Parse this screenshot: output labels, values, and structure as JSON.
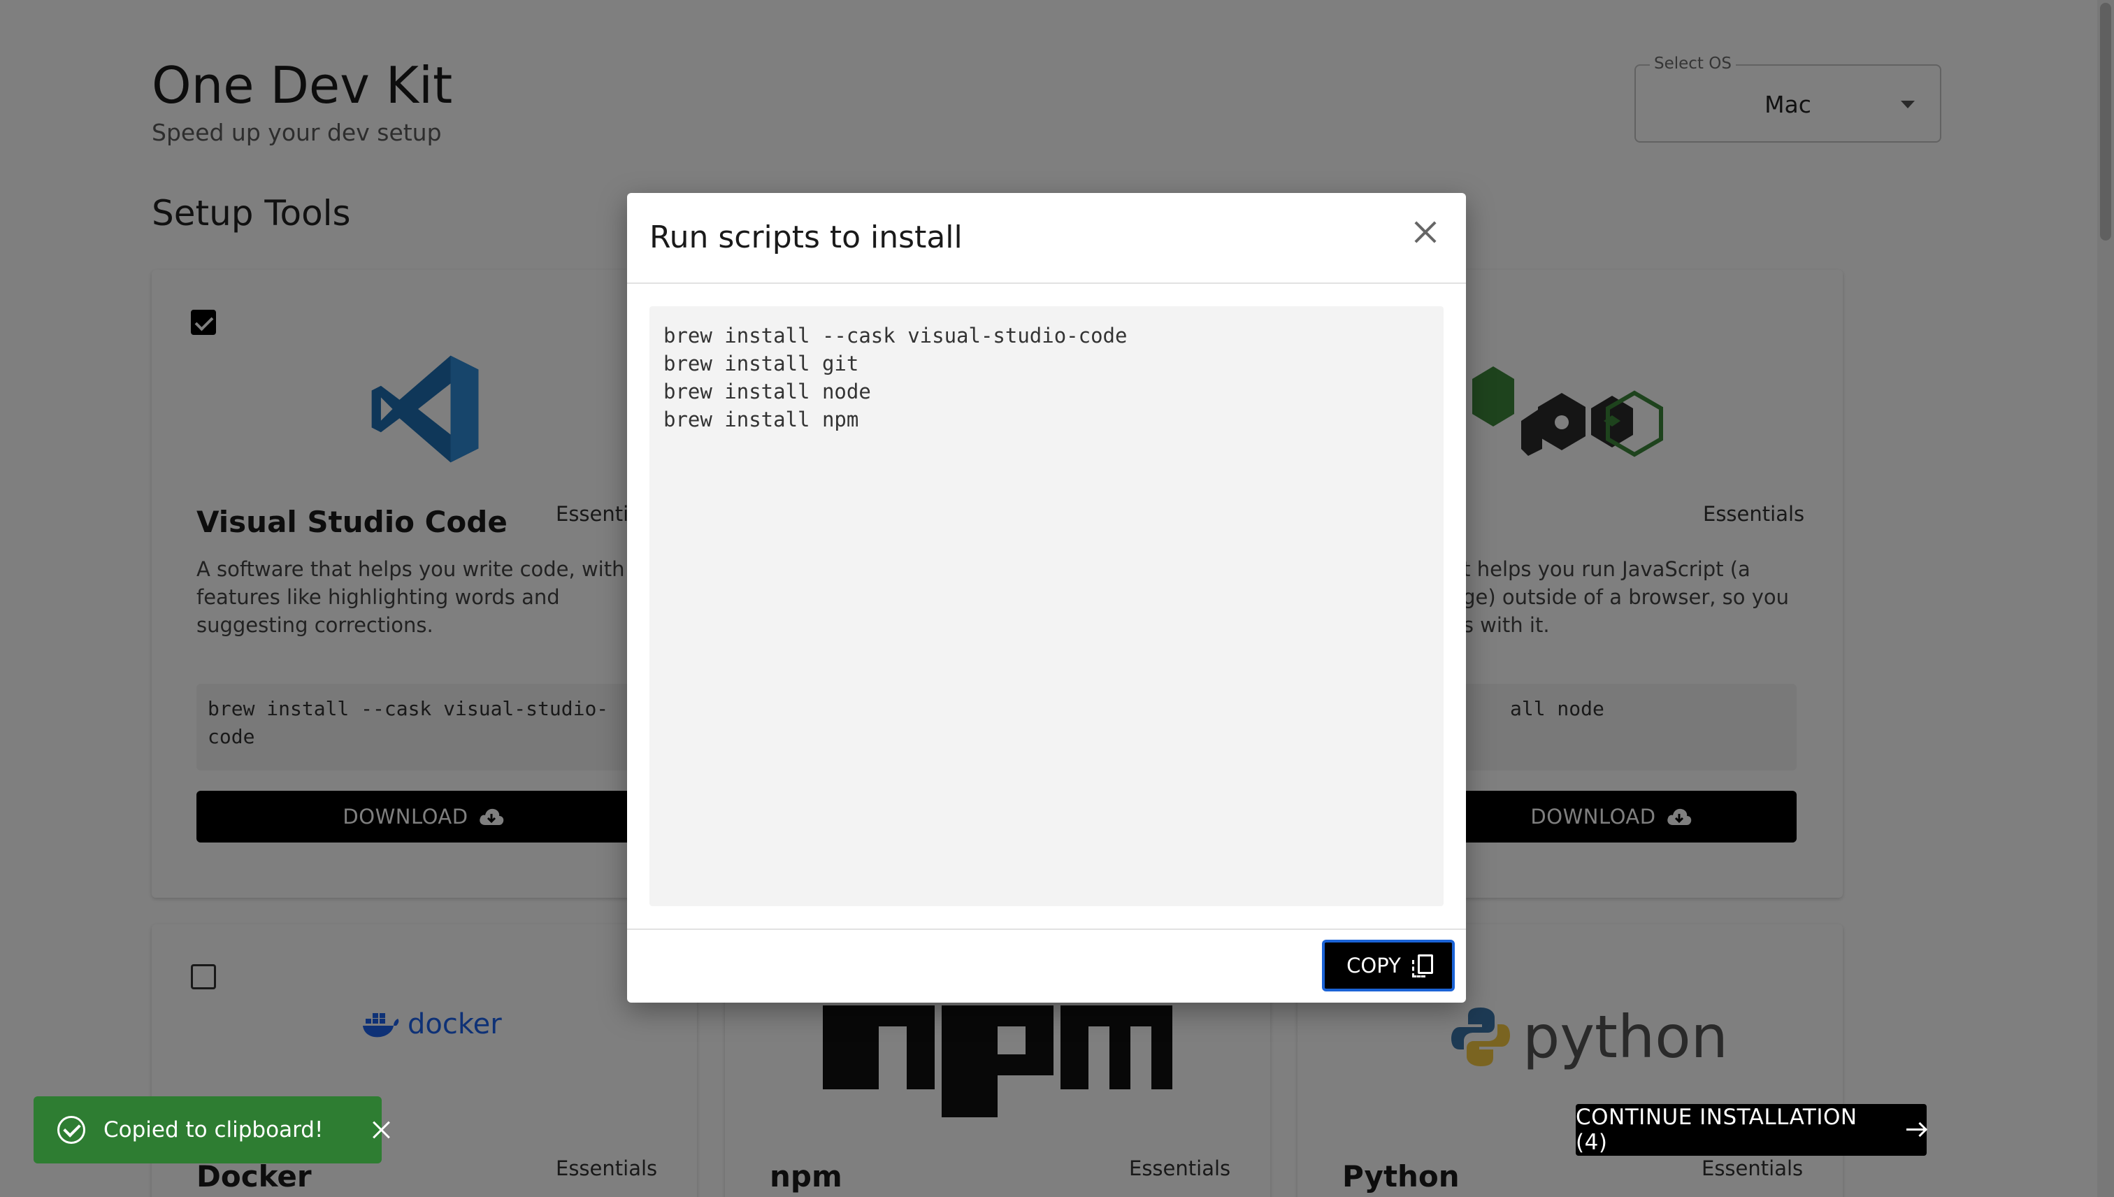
{
  "header": {
    "title": "One Dev Kit",
    "subtitle": "Speed up your dev setup",
    "os_select": {
      "label": "Select OS",
      "value": "Mac"
    }
  },
  "section": {
    "title": "Setup Tools"
  },
  "cards": {
    "vscode": {
      "checked": true,
      "title": "Visual Studio Code",
      "tag": "Essentials",
      "description_lines": [
        "A software that helps you write code, with",
        "features like highlighting words and",
        "suggesting corrections."
      ],
      "command_lines": [
        "brew install --cask visual-studio-",
        "code"
      ],
      "download_label": "DOWNLOAD",
      "logo_icon": "vscode-logo"
    },
    "node": {
      "tag": "Essentials",
      "description_lines": [
        "hat helps you run JavaScript (a",
        "uage) outside of a browser, so you",
        "pps with it."
      ],
      "command_lines": [
        "all node"
      ],
      "download_label": "DOWNLOAD",
      "logo_icon": "nodejs-logo",
      "logo_text": "de"
    },
    "docker": {
      "checked": false,
      "title": "Docker",
      "tag": "Essentials",
      "logo_text": "docker",
      "logo_icon": "docker-logo"
    },
    "npm": {
      "title": "npm",
      "tag": "Essentials",
      "logo_text": "npm",
      "logo_icon": "npm-logo"
    },
    "python": {
      "title": "Python",
      "tag": "Essentials",
      "logo_text": "python",
      "logo_icon": "python-logo"
    }
  },
  "modal": {
    "title": "Run scripts to install",
    "script_lines": [
      "brew install --cask visual-studio-code",
      "brew install git",
      "brew install node",
      "brew install npm"
    ],
    "copy_label": "COPY"
  },
  "toast": {
    "text": "Copied to clipboard!",
    "icon": "check-circle-icon"
  },
  "continue": {
    "label": "CONTINUE INSTALLATION (4)",
    "icon": "arrow-right-icon"
  },
  "colors": {
    "overlay": "rgba(0,0,0,0.5)",
    "toast": "#2e7d32",
    "button": "#000000",
    "copy_focus": "#1b63d6",
    "vscode_blue": "#1f6fb3",
    "node_green": "#3c873a"
  }
}
